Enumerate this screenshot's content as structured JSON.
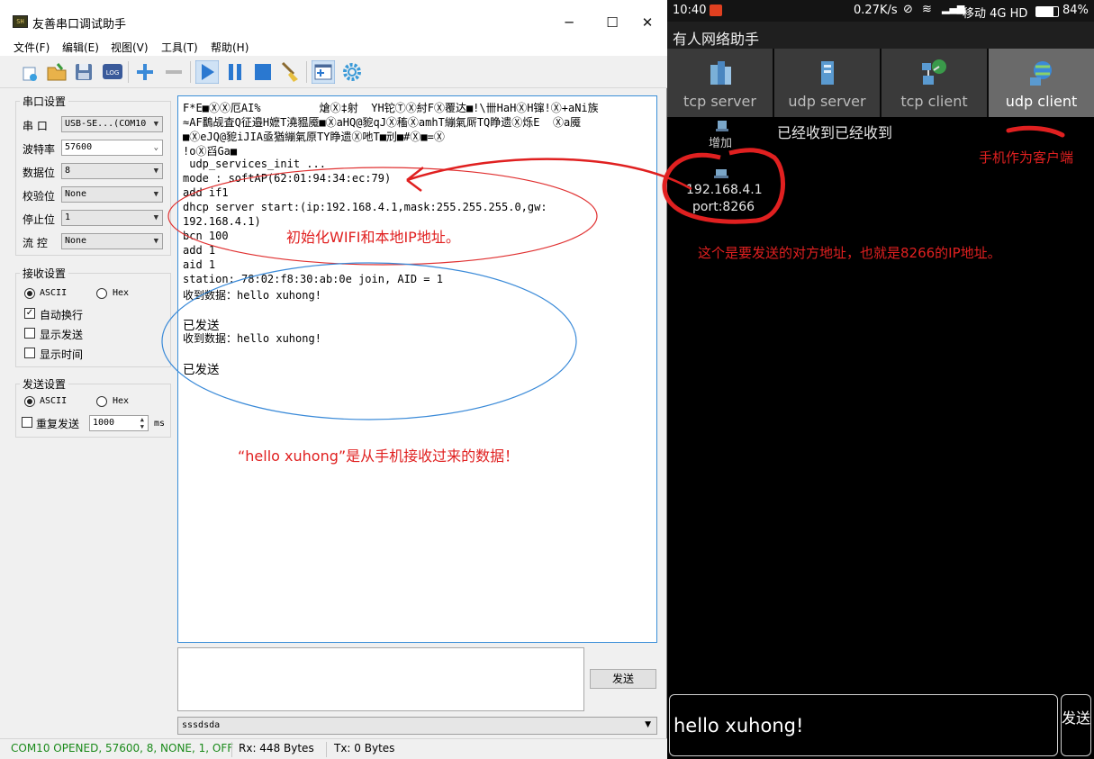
{
  "window": {
    "title": "友善串口调试助手",
    "icon_text": "SH",
    "minimize": "─",
    "maximize": "☐",
    "close": "✕"
  },
  "menu": [
    "文件(F)",
    "编辑(E)",
    "视图(V)",
    "工具(T)",
    "帮助(H)"
  ],
  "toolbar": {
    "log_label": "LOG"
  },
  "serial_settings": {
    "title": "串口设置",
    "port_label": "串 口",
    "port_value": "USB-SE...(COM10",
    "baud_label": "波特率",
    "baud_value": "57600",
    "databits_label": "数据位",
    "databits_value": "8",
    "parity_label": "校验位",
    "parity_value": "None",
    "stopbits_label": "停止位",
    "stopbits_value": "1",
    "flow_label": "流 控",
    "flow_value": "None"
  },
  "receive_settings": {
    "title": "接收设置",
    "ascii": "ASCII",
    "hex": "Hex",
    "auto_newline": "自动换行",
    "show_send": "显示发送",
    "show_time": "显示时间"
  },
  "send_settings": {
    "title": "发送设置",
    "ascii": "ASCII",
    "hex": "Hex",
    "repeat": "重复发送",
    "interval": "1000",
    "unit": "ms"
  },
  "console_lines": [
    "F*E■ⓍⓍ厄AI%         熗Ⓧ‡射  YH铊ⓉⓍ紂FⓍ覆达■!\\卌HaHⓍH镩!Ⓧ+aNi族",
    "≈AF鷭觇査Q征邉H嬷T澆豱魇■ⓍaHQ@豟qJⓍ稸ⓍamhT繃氣厛TQ睁遗Ⓧ烁E  Ⓧa魇",
    "■ⓍeJQ@豟iJIA亟猶繃氣原TY睁遗Ⓧ吔T■刓■#Ⓧ■=Ⓧ",
    "!oⓍ舀Ga■",
    " udp_services_init ...",
    "mode : softAP(62:01:94:34:ec:79)",
    "add if1",
    "dhcp server start:(ip:192.168.4.1,mask:255.255.255.0,gw:",
    "192.168.4.1)",
    "bcn 100",
    "add 1",
    "aid 1",
    "station: 78:02:f8:30:ab:0e join, AID = 1",
    "收到数据：hello xuhong!",
    "已发送",
    "收到数据：hello xuhong!",
    "已发送"
  ],
  "send_button": "发送",
  "send_history": "sssdsda",
  "status": {
    "port": "COM10 OPENED, 57600, 8, NONE, 1, OFF",
    "rx": "Rx: 448 Bytes",
    "tx": "Tx: 0 Bytes"
  },
  "annotations": {
    "init": "初始化WIFI和本地IP地址。",
    "received": "“hello xuhong”是从手机接收过来的数据！",
    "client": "手机作为客户端",
    "target": "这个是要发送的对方地址，也就是8266的IP地址。"
  },
  "phone": {
    "time": "10:40",
    "speed": "0.27K/s",
    "carrier": "移动 4G HD",
    "battery": "84%",
    "app_title": "有人网络助手",
    "tabs": [
      "tcp server",
      "udp server",
      "tcp client",
      "udp client"
    ],
    "add_label": "增加",
    "received_text": "已经收到已经收到",
    "target_ip": "192.168.4.1",
    "target_port": "port:8266",
    "input_value": "hello xuhong!",
    "send_label": "发送"
  },
  "colors": {
    "annotation": "#e02020",
    "console_border": "#3b8fd8",
    "status_text": "#1a8a1a",
    "phone_tab_active": "#6a6a6a"
  }
}
